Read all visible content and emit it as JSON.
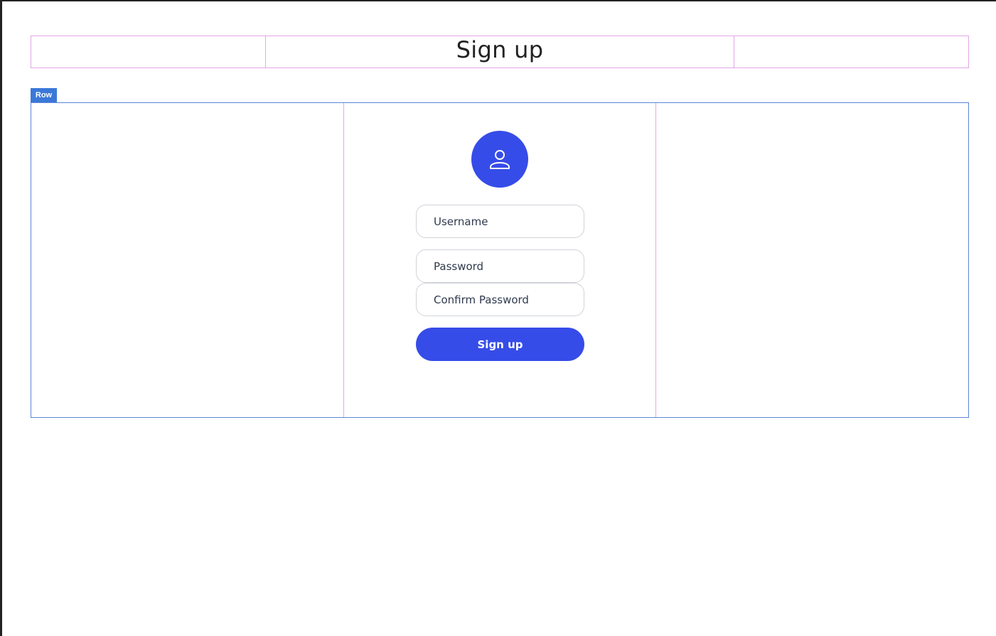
{
  "header": {
    "title": "Sign up"
  },
  "layout_badge": {
    "label": "Row"
  },
  "form": {
    "avatar_icon": "user-icon",
    "username": {
      "value": "",
      "placeholder": "Username"
    },
    "password": {
      "value": "",
      "placeholder": "Password"
    },
    "confirm_password": {
      "value": "",
      "placeholder": "Confirm Password"
    },
    "submit_label": "Sign up"
  },
  "colors": {
    "primary": "#364ce8",
    "column_outline": "#e3a6e6",
    "row_outline": "#5a86d6",
    "badge": "#3a78d8",
    "field_border": "#d0d3d9",
    "text": "#2f3a4e"
  }
}
